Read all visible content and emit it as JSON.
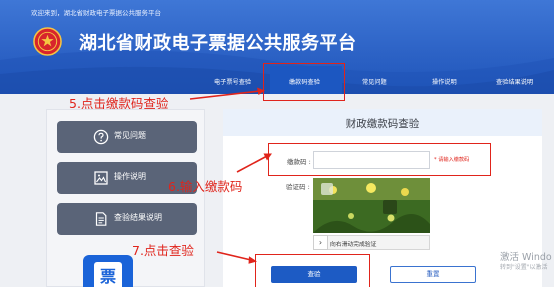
{
  "header": {
    "welcome": "欢迎来到，湖北省财政电子票据公共服务平台",
    "title": "湖北省财政电子票据公共服务平台",
    "emblem_icon": "national-emblem-icon"
  },
  "nav": {
    "items": [
      {
        "label": "电子票号查验"
      },
      {
        "label": "缴款码查验"
      },
      {
        "label": "常见问题"
      },
      {
        "label": "操作说明"
      },
      {
        "label": "查验结果说明"
      }
    ],
    "active_index": 1
  },
  "sidebar": {
    "items": [
      {
        "label": "常见问题",
        "icon": "question-icon"
      },
      {
        "label": "操作说明",
        "icon": "image-doc-icon"
      },
      {
        "label": "查验结果说明",
        "icon": "document-icon"
      }
    ],
    "app_tile_char": "票"
  },
  "main": {
    "title": "财政缴款码查验",
    "code_label": "缴款码 :",
    "code_value": "",
    "code_hint": "* 请输入缴款码",
    "captcha_label": "验证码 :",
    "slider_text": "向右滑动完成验证",
    "slider_handle": "›",
    "check_button": "查验",
    "reset_button": "重置"
  },
  "annotations": {
    "step5": "5.点击缴款码查验",
    "step6": "6.输入缴款码",
    "step7": "7.点击查验"
  },
  "os_watermark": {
    "line1": "激活 Windo",
    "line2": "转到\"设置\"以激活"
  },
  "colors": {
    "header_blue": "#2d63c6",
    "annotation_red": "#e0241b",
    "button_blue": "#1d5bc4",
    "sidebar_button": "#5a6478"
  }
}
